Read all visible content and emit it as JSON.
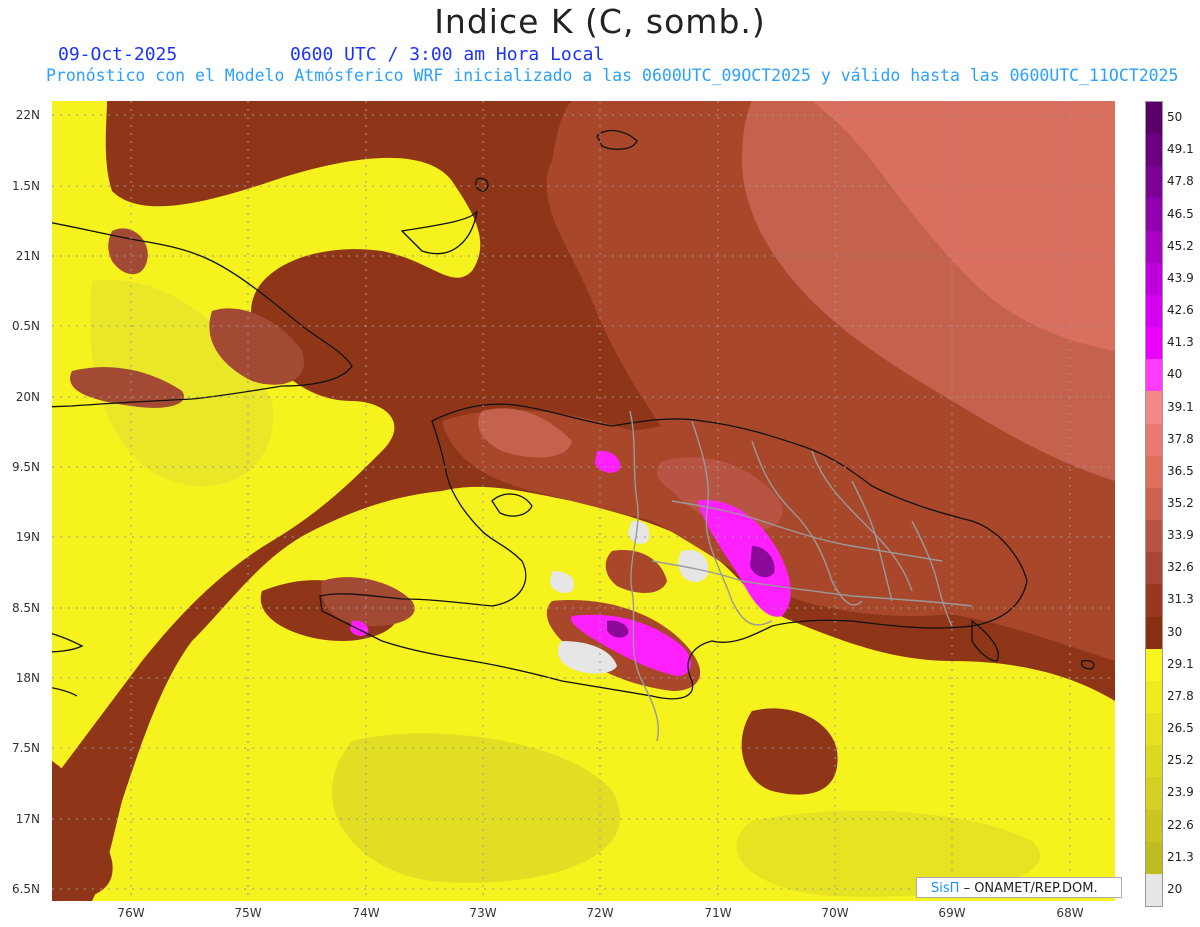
{
  "title": "Indice K (C, somb.)",
  "date_label": "09-Oct-2025",
  "time_label": "0600 UTC / 3:00 am Hora Local",
  "subtitle": "Pronóstico con el Modelo Atmósferico WRF inicializado a las 0600UTC_09OCT2025 y válido hasta las  0600UTC_11OCT2025",
  "credit": {
    "brand": "SisΠ",
    "text": "– ONAMET/REP.DOM."
  },
  "map": {
    "latitude_ticks": [
      "22N",
      "1.5N",
      "21N",
      "0.5N",
      "20N",
      "9.5N",
      "19N",
      "8.5N",
      "18N",
      "7.5N",
      "17N",
      "6.5N"
    ],
    "longitude_ticks": [
      "76W",
      "75W",
      "74W",
      "73W",
      "72W",
      "71W",
      "70W",
      "69W",
      "68W"
    ],
    "colors": {
      "background_low": "#f6f21e",
      "yellow_dark": "#dcd825",
      "brown_dark": "#8f3619",
      "brown_mid": "#a8472a",
      "brown_light": "#c5624d",
      "salmon": "#d9705f",
      "magenta": "#ff20ff",
      "purple": "#8c0a9a",
      "gray": "#e6e6e6"
    }
  },
  "colorbar": {
    "levels": [
      "50",
      "49.1",
      "47.8",
      "46.5",
      "45.2",
      "43.9",
      "42.6",
      "41.3",
      "40",
      "39.1",
      "37.8",
      "36.5",
      "35.2",
      "33.9",
      "32.6",
      "31.3",
      "30",
      "29.1",
      "27.8",
      "26.5",
      "25.2",
      "23.9",
      "22.6",
      "21.3",
      "20"
    ],
    "colors": [
      "#5a0068",
      "#6a0080",
      "#7d0096",
      "#9100ae",
      "#a900c6",
      "#c000dc",
      "#d500ef",
      "#eb00ff",
      "#ff3cff",
      "#f48a88",
      "#e97a71",
      "#dd6f5f",
      "#cc6150",
      "#b85443",
      "#a84736",
      "#97391f",
      "#8a2e12",
      "#f7f41e",
      "#eeeb1f",
      "#e5e220",
      "#dcda20",
      "#d2d021",
      "#c9c621",
      "#bfbc21",
      "#e6e6e6"
    ]
  }
}
